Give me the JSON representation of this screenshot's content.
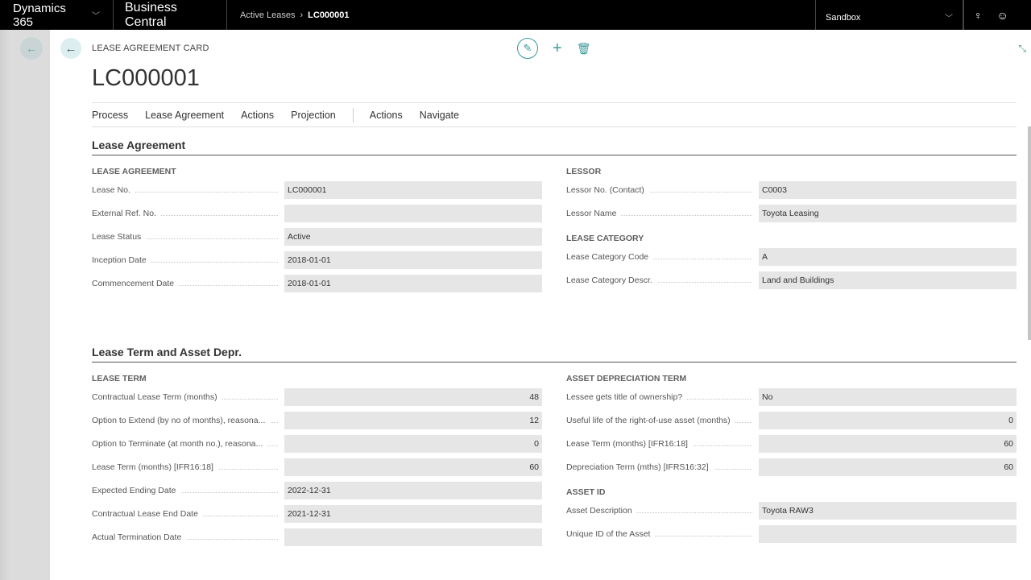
{
  "topbar": {
    "app": "Dynamics 365",
    "product": "Business Central",
    "breadcrumb": [
      "Active Leases",
      "LC000001"
    ],
    "environment": "Sandbox"
  },
  "header": {
    "caption": "LEASE AGREEMENT CARD",
    "title": "LC000001"
  },
  "menu": [
    "Process",
    "Lease Agreement",
    "Actions",
    "Projection",
    "Actions",
    "Navigate"
  ],
  "accent": "#3a9a9a",
  "sections": [
    {
      "title": "Lease Agreement",
      "columns": [
        {
          "groups": [
            {
              "title": "LEASE AGREEMENT",
              "fields": [
                {
                  "label": "Lease No.",
                  "value": "LC000001"
                },
                {
                  "label": "External Ref. No.",
                  "value": ""
                },
                {
                  "label": "Lease Status",
                  "value": "Active"
                },
                {
                  "label": "Inception Date",
                  "value": "2018-01-01"
                },
                {
                  "label": "Commencement Date",
                  "value": "2018-01-01"
                }
              ]
            }
          ]
        },
        {
          "groups": [
            {
              "title": "LESSOR",
              "fields": [
                {
                  "label": "Lessor No. (Contact)",
                  "value": "C0003"
                },
                {
                  "label": "Lessor Name",
                  "value": "Toyota Leasing"
                }
              ]
            },
            {
              "title": "LEASE CATEGORY",
              "fields": [
                {
                  "label": "Lease Category Code",
                  "value": "A"
                },
                {
                  "label": "Lease Category Descr.",
                  "value": "Land and Buildings"
                }
              ]
            }
          ]
        }
      ]
    },
    {
      "title": "Lease Term and Asset Depr.",
      "columns": [
        {
          "groups": [
            {
              "title": "LEASE TERM",
              "fields": [
                {
                  "label": "Contractual Lease Term (months)",
                  "value": "48",
                  "num": true
                },
                {
                  "label": "Option to Extend (by no of months), reasona...",
                  "value": "12",
                  "num": true
                },
                {
                  "label": "Option to Terminate (at month no.), reasona...",
                  "value": "0",
                  "num": true
                },
                {
                  "label": "Lease Term (months) [IFR16:18]",
                  "value": "60",
                  "num": true
                },
                {
                  "label": "Expected Ending Date",
                  "value": "2022-12-31"
                },
                {
                  "label": "Contractual Lease End Date",
                  "value": "2021-12-31"
                },
                {
                  "label": "Actual Termination Date",
                  "value": ""
                }
              ]
            }
          ]
        },
        {
          "groups": [
            {
              "title": "ASSET DEPRECIATION TERM",
              "fields": [
                {
                  "label": "Lessee gets title of ownership?",
                  "value": "No"
                },
                {
                  "label": "Useful life of the right-of-use asset (months)",
                  "value": "0",
                  "num": true
                },
                {
                  "label": "Lease Term (months) [IFR16:18]",
                  "value": "60",
                  "num": true
                },
                {
                  "label": "Depreciation Term (mths) [IFRS16:32]",
                  "value": "60",
                  "num": true
                }
              ]
            },
            {
              "title": "ASSET ID",
              "fields": [
                {
                  "label": "Asset Description",
                  "value": "Toyota RAW3"
                },
                {
                  "label": "Unique ID of the Asset",
                  "value": ""
                }
              ]
            }
          ]
        }
      ]
    }
  ]
}
